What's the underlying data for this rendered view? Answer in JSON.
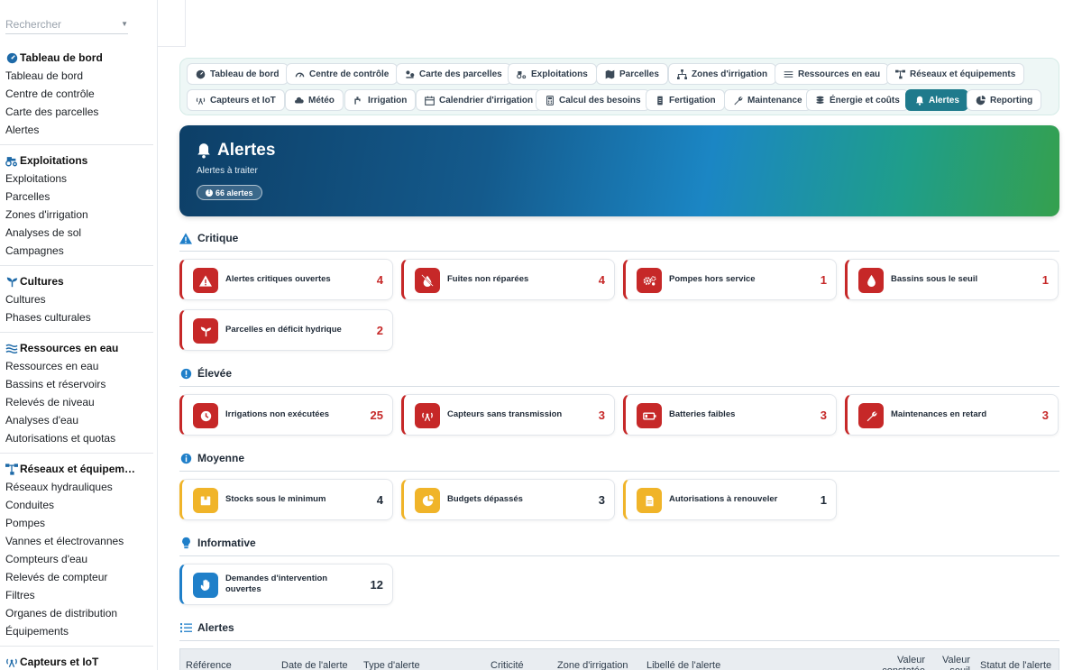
{
  "sidebar": {
    "search_placeholder": "Rechercher",
    "sections": [
      {
        "title": "Tableau de bord",
        "icon": "gauge-icon",
        "items": [
          "Tableau de bord",
          "Centre de contrôle",
          "Carte des parcelles",
          "Alertes"
        ]
      },
      {
        "title": "Exploitations",
        "icon": "tractor-icon",
        "items": [
          "Exploitations",
          "Parcelles",
          "Zones d'irrigation",
          "Analyses de sol",
          "Campagnes"
        ]
      },
      {
        "title": "Cultures",
        "icon": "seedling-icon",
        "items": [
          "Cultures",
          "Phases culturales"
        ]
      },
      {
        "title": "Ressources en eau",
        "icon": "water-icon",
        "items": [
          "Ressources en eau",
          "Bassins et réservoirs",
          "Relevés de niveau",
          "Analyses d'eau",
          "Autorisations et quotas"
        ]
      },
      {
        "title": "Réseaux et équipem…",
        "icon": "network-icon",
        "items": [
          "Réseaux hydrauliques",
          "Conduites",
          "Pompes",
          "Vannes et électrovannes",
          "Compteurs d'eau",
          "Relevés de compteur",
          "Filtres",
          "Organes de distribution",
          "Équipements"
        ]
      },
      {
        "title": "Capteurs et IoT",
        "icon": "antenna-icon",
        "items": []
      }
    ]
  },
  "tabs": [
    {
      "label": "Tableau de bord",
      "icon": "gauge-icon",
      "active": false
    },
    {
      "label": "Centre de contrôle",
      "icon": "dashboard-icon",
      "active": false
    },
    {
      "label": "Carte des parcelles",
      "icon": "map-pins-icon",
      "active": false
    },
    {
      "label": "Exploitations",
      "icon": "tractor-icon",
      "active": false
    },
    {
      "label": "Parcelles",
      "icon": "map-icon",
      "active": false
    },
    {
      "label": "Zones d'irrigation",
      "icon": "sitemap-icon",
      "active": false
    },
    {
      "label": "Ressources en eau",
      "icon": "water-icon",
      "active": false
    },
    {
      "label": "Réseaux et équipements",
      "icon": "network-icon",
      "active": false
    },
    {
      "label": "Capteurs et IoT",
      "icon": "antenna-icon",
      "active": false
    },
    {
      "label": "Météo",
      "icon": "cloud-icon",
      "active": false
    },
    {
      "label": "Irrigation",
      "icon": "faucet-icon",
      "active": false
    },
    {
      "label": "Calendrier d'irrigation",
      "icon": "calendar-icon",
      "active": false
    },
    {
      "label": "Calcul des besoins",
      "icon": "calculator-icon",
      "active": false
    },
    {
      "label": "Fertigation",
      "icon": "flask-icon",
      "active": false
    },
    {
      "label": "Maintenance",
      "icon": "wrench-icon",
      "active": false
    },
    {
      "label": "Énergie et coûts",
      "icon": "coins-icon",
      "active": false
    },
    {
      "label": "Alertes",
      "icon": "bell-icon",
      "active": true
    },
    {
      "label": "Reporting",
      "icon": "pie-chart-icon",
      "active": false
    }
  ],
  "banner": {
    "title": "Alertes",
    "subtitle": "Alertes à traiter",
    "badge": "66 alertes"
  },
  "sections": [
    {
      "title": "Critique",
      "icon": "warning-triangle-icon",
      "color": "#1f7fc9",
      "level": "red",
      "cards": [
        {
          "label": "Alertes critiques ouvertes",
          "value": "4",
          "icon": "warning-icon"
        },
        {
          "label": "Fuites non réparées",
          "value": "4",
          "icon": "no-drop-icon"
        },
        {
          "label": "Pompes hors service",
          "value": "1",
          "icon": "gears-icon"
        },
        {
          "label": "Bassins sous le seuil",
          "value": "1",
          "icon": "drop-icon"
        },
        {
          "label": "Parcelles en déficit hydrique",
          "value": "2",
          "icon": "seedling-icon"
        }
      ]
    },
    {
      "title": "Élevée",
      "icon": "info-circle-icon",
      "color": "#1f7fc9",
      "level": "red",
      "cards": [
        {
          "label": "Irrigations non exécutées",
          "value": "25",
          "icon": "clock-icon"
        },
        {
          "label": "Capteurs sans transmission",
          "value": "3",
          "icon": "antenna-icon"
        },
        {
          "label": "Batteries faibles",
          "value": "3",
          "icon": "battery-icon"
        },
        {
          "label": "Maintenances en retard",
          "value": "3",
          "icon": "wrench-icon"
        }
      ]
    },
    {
      "title": "Moyenne",
      "icon": "info-circle-icon",
      "color": "#1f7fc9",
      "level": "yellow",
      "cards": [
        {
          "label": "Stocks sous le minimum",
          "value": "4",
          "icon": "box-icon"
        },
        {
          "label": "Budgets dépassés",
          "value": "3",
          "icon": "pie-chart-icon"
        },
        {
          "label": "Autorisations à renouveler",
          "value": "1",
          "icon": "document-icon"
        }
      ]
    },
    {
      "title": "Informative",
      "icon": "lightbulb-icon",
      "color": "#1f7fc9",
      "level": "blue",
      "cards": [
        {
          "label": "Demandes d'intervention ouvertes",
          "value": "12",
          "icon": "hand-icon"
        }
      ]
    }
  ],
  "table": {
    "title": "Alertes",
    "columns": [
      "Référence",
      "Date de l'alerte",
      "Type d'alerte",
      "Criticité",
      "Zone d'irrigation",
      "Libellé de l'alerte",
      "Valeur constatée",
      "Valeur seuil",
      "Statut de l'alerte"
    ]
  }
}
